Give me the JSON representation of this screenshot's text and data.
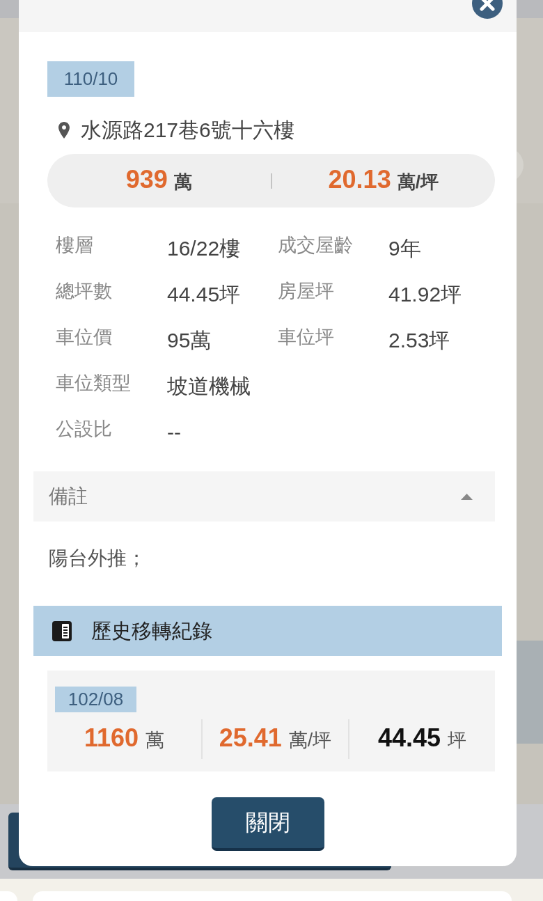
{
  "dialog": {
    "date": "110/10",
    "address": "水源路217巷6號十六樓",
    "price_summary": [
      {
        "kind": "price",
        "value": "939",
        "unit": "萬"
      },
      {
        "kind": "price",
        "value": "20.13",
        "unit": "萬/坪"
      }
    ],
    "detail_rows": [
      [
        {
          "label": "樓層",
          "value": "16/22樓"
        },
        {
          "label": "成交屋齡",
          "value": "9年"
        }
      ],
      [
        {
          "label": "總坪數",
          "value": "44.45坪"
        },
        {
          "label": "房屋坪",
          "value": "41.92坪"
        }
      ],
      [
        {
          "label": "車位價",
          "value": "95萬"
        },
        {
          "label": "車位坪",
          "value": "2.53坪"
        }
      ],
      [
        {
          "label": "車位類型",
          "value": "坡道機械"
        }
      ],
      [
        {
          "label": "公設比",
          "value": "--"
        }
      ]
    ],
    "remarks": {
      "title": "備註",
      "expanded": true,
      "text": "陽台外推；"
    },
    "history": {
      "title": "歷史移轉紀錄",
      "records": [
        {
          "date": "102/08",
          "stats": [
            {
              "kind": "price",
              "value": "1160",
              "unit": "萬"
            },
            {
              "kind": "price",
              "value": "25.41",
              "unit": "萬/坪"
            },
            {
              "kind": "area",
              "value": "44.45",
              "unit": "坪"
            }
          ]
        }
      ]
    },
    "buttons": [
      {
        "label": "關閉"
      }
    ]
  }
}
